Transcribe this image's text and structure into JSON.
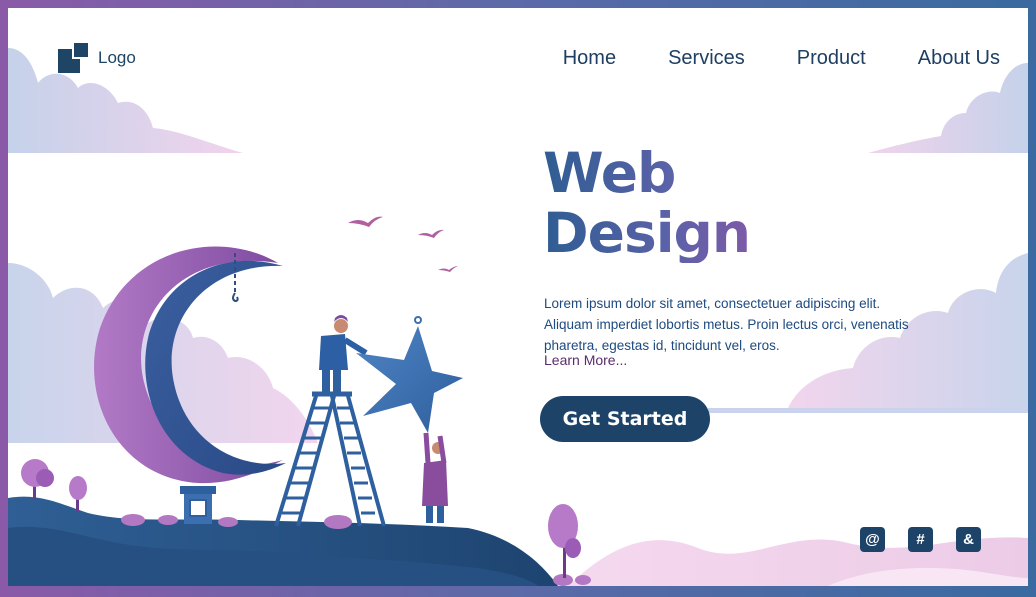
{
  "header": {
    "logo_label": "Logo",
    "nav": [
      {
        "label": "Home"
      },
      {
        "label": "Services"
      },
      {
        "label": "Product"
      },
      {
        "label": "About Us"
      }
    ]
  },
  "hero": {
    "title_line1": "Web",
    "title_line2": "Design",
    "description": "Lorem ipsum dolor sit amet, consectetuer adipiscing elit. Aliquam imperdiet lobortis metus. Proin lectus orci, venenatis pharetra, egestas id, tincidunt vel, eros.",
    "learn_more": "Learn More...",
    "cta_label": "Get Started"
  },
  "social": [
    {
      "glyph": "@",
      "icon": "at-icon"
    },
    {
      "glyph": "#",
      "icon": "hash-icon"
    },
    {
      "glyph": "&",
      "icon": "ampersand-icon"
    }
  ],
  "colors": {
    "primary": "#1d4468",
    "title_gradient_start": "#2f5d92",
    "title_gradient_end": "#7d5aa8",
    "cloud_pink": "#f0d4ec",
    "cloud_blue": "#c7d3ea",
    "hill": "#2c5b8e"
  }
}
